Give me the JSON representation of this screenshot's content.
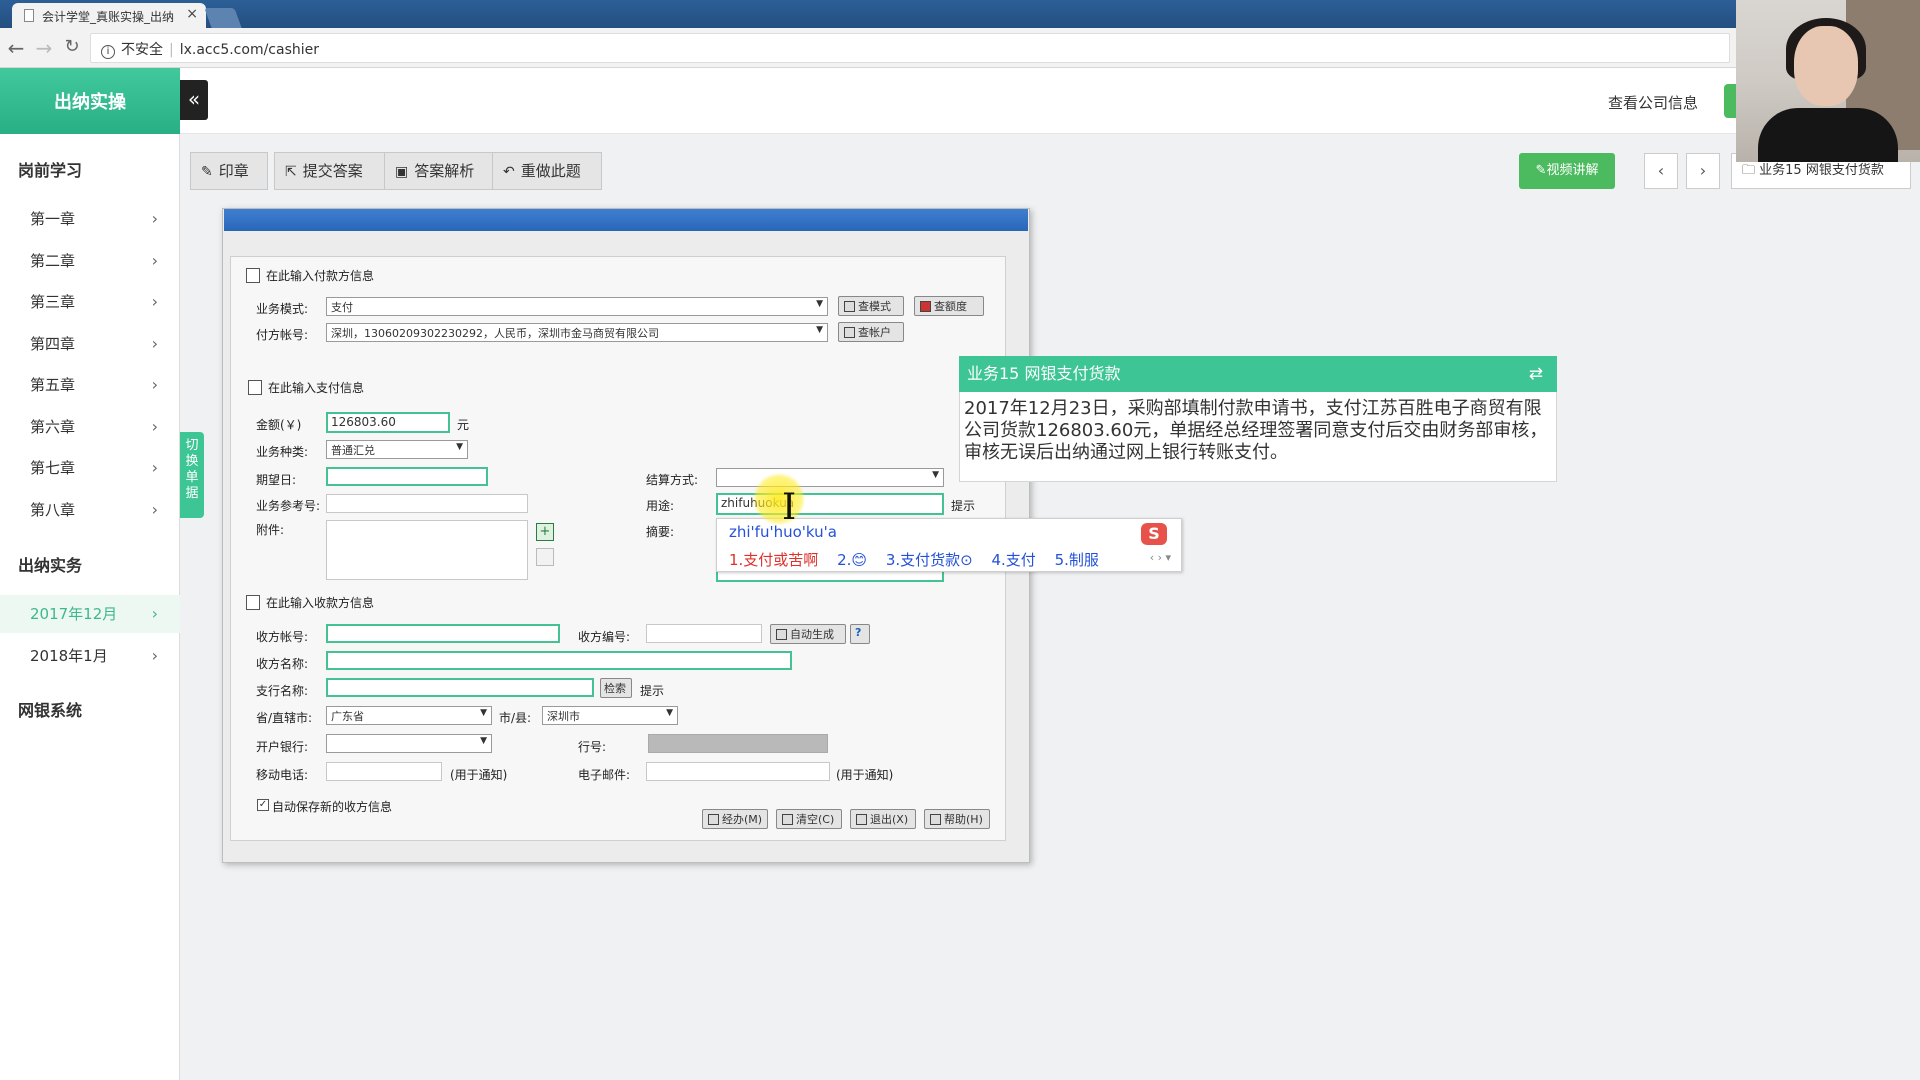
{
  "browser": {
    "tab_title": "会计学堂_真账实操_出纳",
    "security": "不安全",
    "url": "lx.acc5.com/cashier"
  },
  "sidebar": {
    "header": "出纳实操",
    "collapse_icon": "«",
    "section_prestudy": "岗前学习",
    "chapters": [
      "第一章",
      "第二章",
      "第三章",
      "第四章",
      "第五章",
      "第六章",
      "第七章",
      "第八章"
    ],
    "section_practice": "出纳实务",
    "months": [
      "2017年12月",
      "2018年1月"
    ],
    "section_bank": "网银系统",
    "switch_label": "切换单据"
  },
  "header": {
    "company_info": "查看公司信息"
  },
  "toolbar": {
    "stamp": "印章",
    "submit": "提交答案",
    "analysis": "答案解析",
    "redo": "重做此题",
    "video": "✎视频讲解",
    "prev": "‹",
    "next": "›",
    "business": "业务15 网银支付货款"
  },
  "dialog": {
    "payer_section": "在此输入付款方信息",
    "biz_mode_label": "业务模式:",
    "biz_mode_value": "支付",
    "btn_query_mode": "查模式",
    "btn_query_quota": "查额度",
    "payer_account_label": "付方帐号:",
    "payer_account_value": "深圳，13060209302230292，人民币，深圳市金马商贸有限公司",
    "btn_query_account": "查帐户",
    "pay_section": "在此输入支付信息",
    "amount_label": "金额(￥)",
    "amount_value": "126803.60",
    "amount_unit": "元",
    "biz_type_label": "业务种类:",
    "biz_type_value": "普通汇兑",
    "expect_date_label": "期望日:",
    "settle_label": "结算方式:",
    "biz_ref_label": "业务参考号:",
    "purpose_label": "用途:",
    "purpose_value": "zhifuhuokua",
    "hint1": "提示",
    "attach_label": "附件:",
    "summary_label": "摘要:",
    "payee_section": "在此输入收款方信息",
    "payee_account_label": "收方帐号:",
    "payee_code_label": "收方编号:",
    "btn_auto_gen": "自动生成",
    "help_q": "?",
    "payee_name_label": "收方名称:",
    "branch_label": "支行名称:",
    "btn_search": "检索",
    "hint2": "提示",
    "province_label": "省/直辖市:",
    "province_value": "广东省",
    "city_label": "市/县:",
    "city_value": "深圳市",
    "bank_label": "开户银行:",
    "bank_no_label": "行号:",
    "mobile_label": "移动电话:",
    "notify1": "(用于通知)",
    "email_label": "电子邮件:",
    "notify2": "(用于通知)",
    "autosave_label": "自动保存新的收方信息",
    "btn_handle": "经办(M)",
    "btn_clear": "清空(C)",
    "btn_exit": "退出(X)",
    "btn_help": "帮助(H)"
  },
  "ime": {
    "pinyin": "zhi'fu'huo'ku'a",
    "candidates": [
      "1.支付或苦啊",
      "2.😊",
      "3.支付货款⊙",
      "4.支付",
      "5.制服"
    ],
    "logo": "S",
    "pager": "‹ › ▾"
  },
  "task": {
    "title": "业务15 网银支付货款",
    "swap_icon": "⇄",
    "text": "2017年12月23日，采购部填制付款申请书，支付江苏百胜电子商贸有限公司货款126803.60元，单据经总经理签署同意支付后交由财务部审核，审核无误后出纳通过网上银行转账支付。"
  },
  "colors": {
    "green": "#3ec596",
    "dialog_title": "#2a66b8",
    "active_text": "#3db88b"
  }
}
